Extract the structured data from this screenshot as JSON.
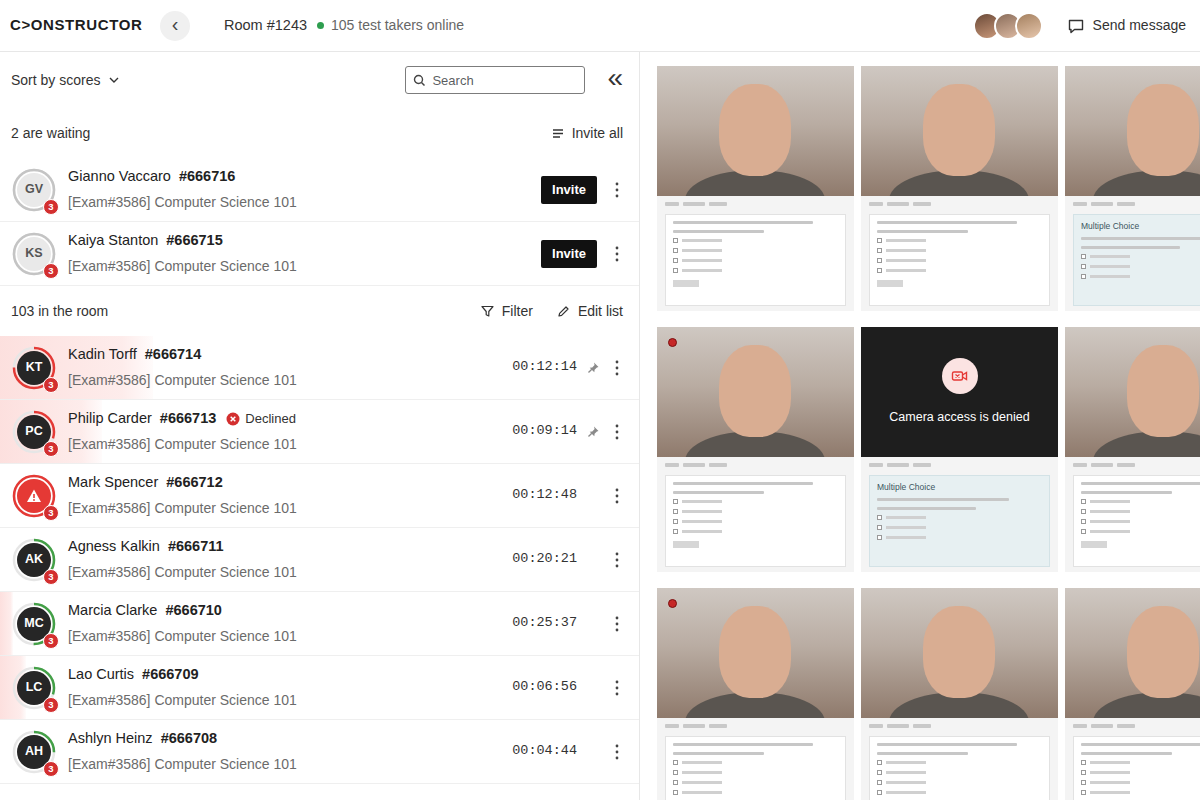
{
  "topbar": {
    "logo": "C>ONSTRUCTOR",
    "back": "‹",
    "room": "Room #1243",
    "online": "105 test takers online",
    "proctors": [
      {
        "kind": "photo"
      },
      {
        "kind": "photo"
      },
      {
        "kind": "photo"
      }
    ],
    "send_message": "Send message"
  },
  "sidebar": {
    "sort": "Sort by scores",
    "search": {
      "placeholder": "Search"
    },
    "collapse": "«",
    "waiting": {
      "title": "2 are waiting",
      "action": "Invite all",
      "items": [
        {
          "initials": "GV",
          "name": "Gianno Vaccaro",
          "id": "#666716",
          "exam": "[Exam#3586] Computer Science 101",
          "badge": "3",
          "button": "Invite",
          "kind": "muted",
          "ring": 1,
          "color": "#c4c4c4"
        },
        {
          "initials": "KS",
          "name": "Kaiya Stanton",
          "id": "#666715",
          "exam": "[Exam#3586] Computer Science 101",
          "badge": "3",
          "button": "Invite",
          "kind": "muted",
          "ring": 1,
          "color": "#c4c4c4"
        }
      ]
    },
    "room": {
      "title": "103 in the room",
      "filter": "Filter",
      "edit": "Edit list",
      "items": [
        {
          "initials": "KT",
          "name": "Kadin Torff",
          "id": "#666714",
          "exam": "[Exam#3586] Computer Science 101",
          "badge": "3",
          "time": "00:12:14",
          "pinned": true,
          "declined": false,
          "kind": "initials",
          "ring": 0.75,
          "color": "#e53935",
          "risk": 0.24
        },
        {
          "initials": "PC",
          "name": "Philip Carder",
          "id": "#666713",
          "status": "Declined",
          "exam": "[Exam#3586] Computer Science 101",
          "badge": "3",
          "time": "00:09:14",
          "pinned": true,
          "declined": true,
          "kind": "initials",
          "ring": 0.3,
          "color": "#e53935",
          "risk": 0.16
        },
        {
          "name": "Mark Spencer",
          "id": "#666712",
          "exam": "[Exam#3586] Computer Science 101",
          "badge": "3",
          "time": "00:12:48",
          "pinned": false,
          "declined": false,
          "kind": "alert",
          "ring": 1,
          "color": "#e53935",
          "risk": 0
        },
        {
          "initials": "AK",
          "name": "Agness Kalkin",
          "id": "#666711",
          "exam": "[Exam#3586] Computer Science 101",
          "badge": "3",
          "time": "00:20:21",
          "pinned": false,
          "declined": false,
          "kind": "initials",
          "ring": 0.35,
          "color": "#43a047",
          "risk": 0
        },
        {
          "initials": "MC",
          "name": "Marcia Clarke",
          "id": "#666710",
          "exam": "[Exam#3586] Computer Science 101",
          "badge": "3",
          "time": "00:25:37",
          "pinned": false,
          "declined": false,
          "kind": "initials",
          "ring": 0.5,
          "color": "#43a047",
          "risk": 0.02
        },
        {
          "initials": "LC",
          "name": "Lao Curtis",
          "id": "#666709",
          "exam": "[Exam#3586] Computer Science 101",
          "badge": "3",
          "time": "00:06:56",
          "pinned": false,
          "declined": false,
          "kind": "initials",
          "ring": 0.3,
          "color": "#43a047",
          "risk": 0.04
        },
        {
          "initials": "AH",
          "name": "Ashlyn Heinz",
          "id": "#666708",
          "exam": "[Exam#3586] Computer Science 101",
          "badge": "3",
          "time": "00:04:44",
          "pinned": false,
          "declined": false,
          "kind": "initials",
          "ring": 0.25,
          "color": "#43a047",
          "risk": 0
        }
      ]
    }
  },
  "tiles": [
    {
      "camera": true,
      "recording": false,
      "screen": "form"
    },
    {
      "camera": true,
      "recording": false,
      "screen": "form"
    },
    {
      "camera": true,
      "recording": false,
      "screen": "multiple-choice",
      "screen_title": "Multiple Choice"
    },
    {
      "camera": true,
      "recording": true,
      "screen": "form"
    },
    {
      "camera": false,
      "message": "Camera access is denied",
      "recording": false,
      "screen": "multiple-choice",
      "screen_title": "Multiple Choice"
    },
    {
      "camera": true,
      "recording": false,
      "screen": "form"
    },
    {
      "camera": true,
      "recording": true,
      "screen": "form"
    },
    {
      "camera": true,
      "recording": false,
      "screen": "form"
    },
    {
      "camera": true,
      "recording": false,
      "screen": "form"
    }
  ]
}
